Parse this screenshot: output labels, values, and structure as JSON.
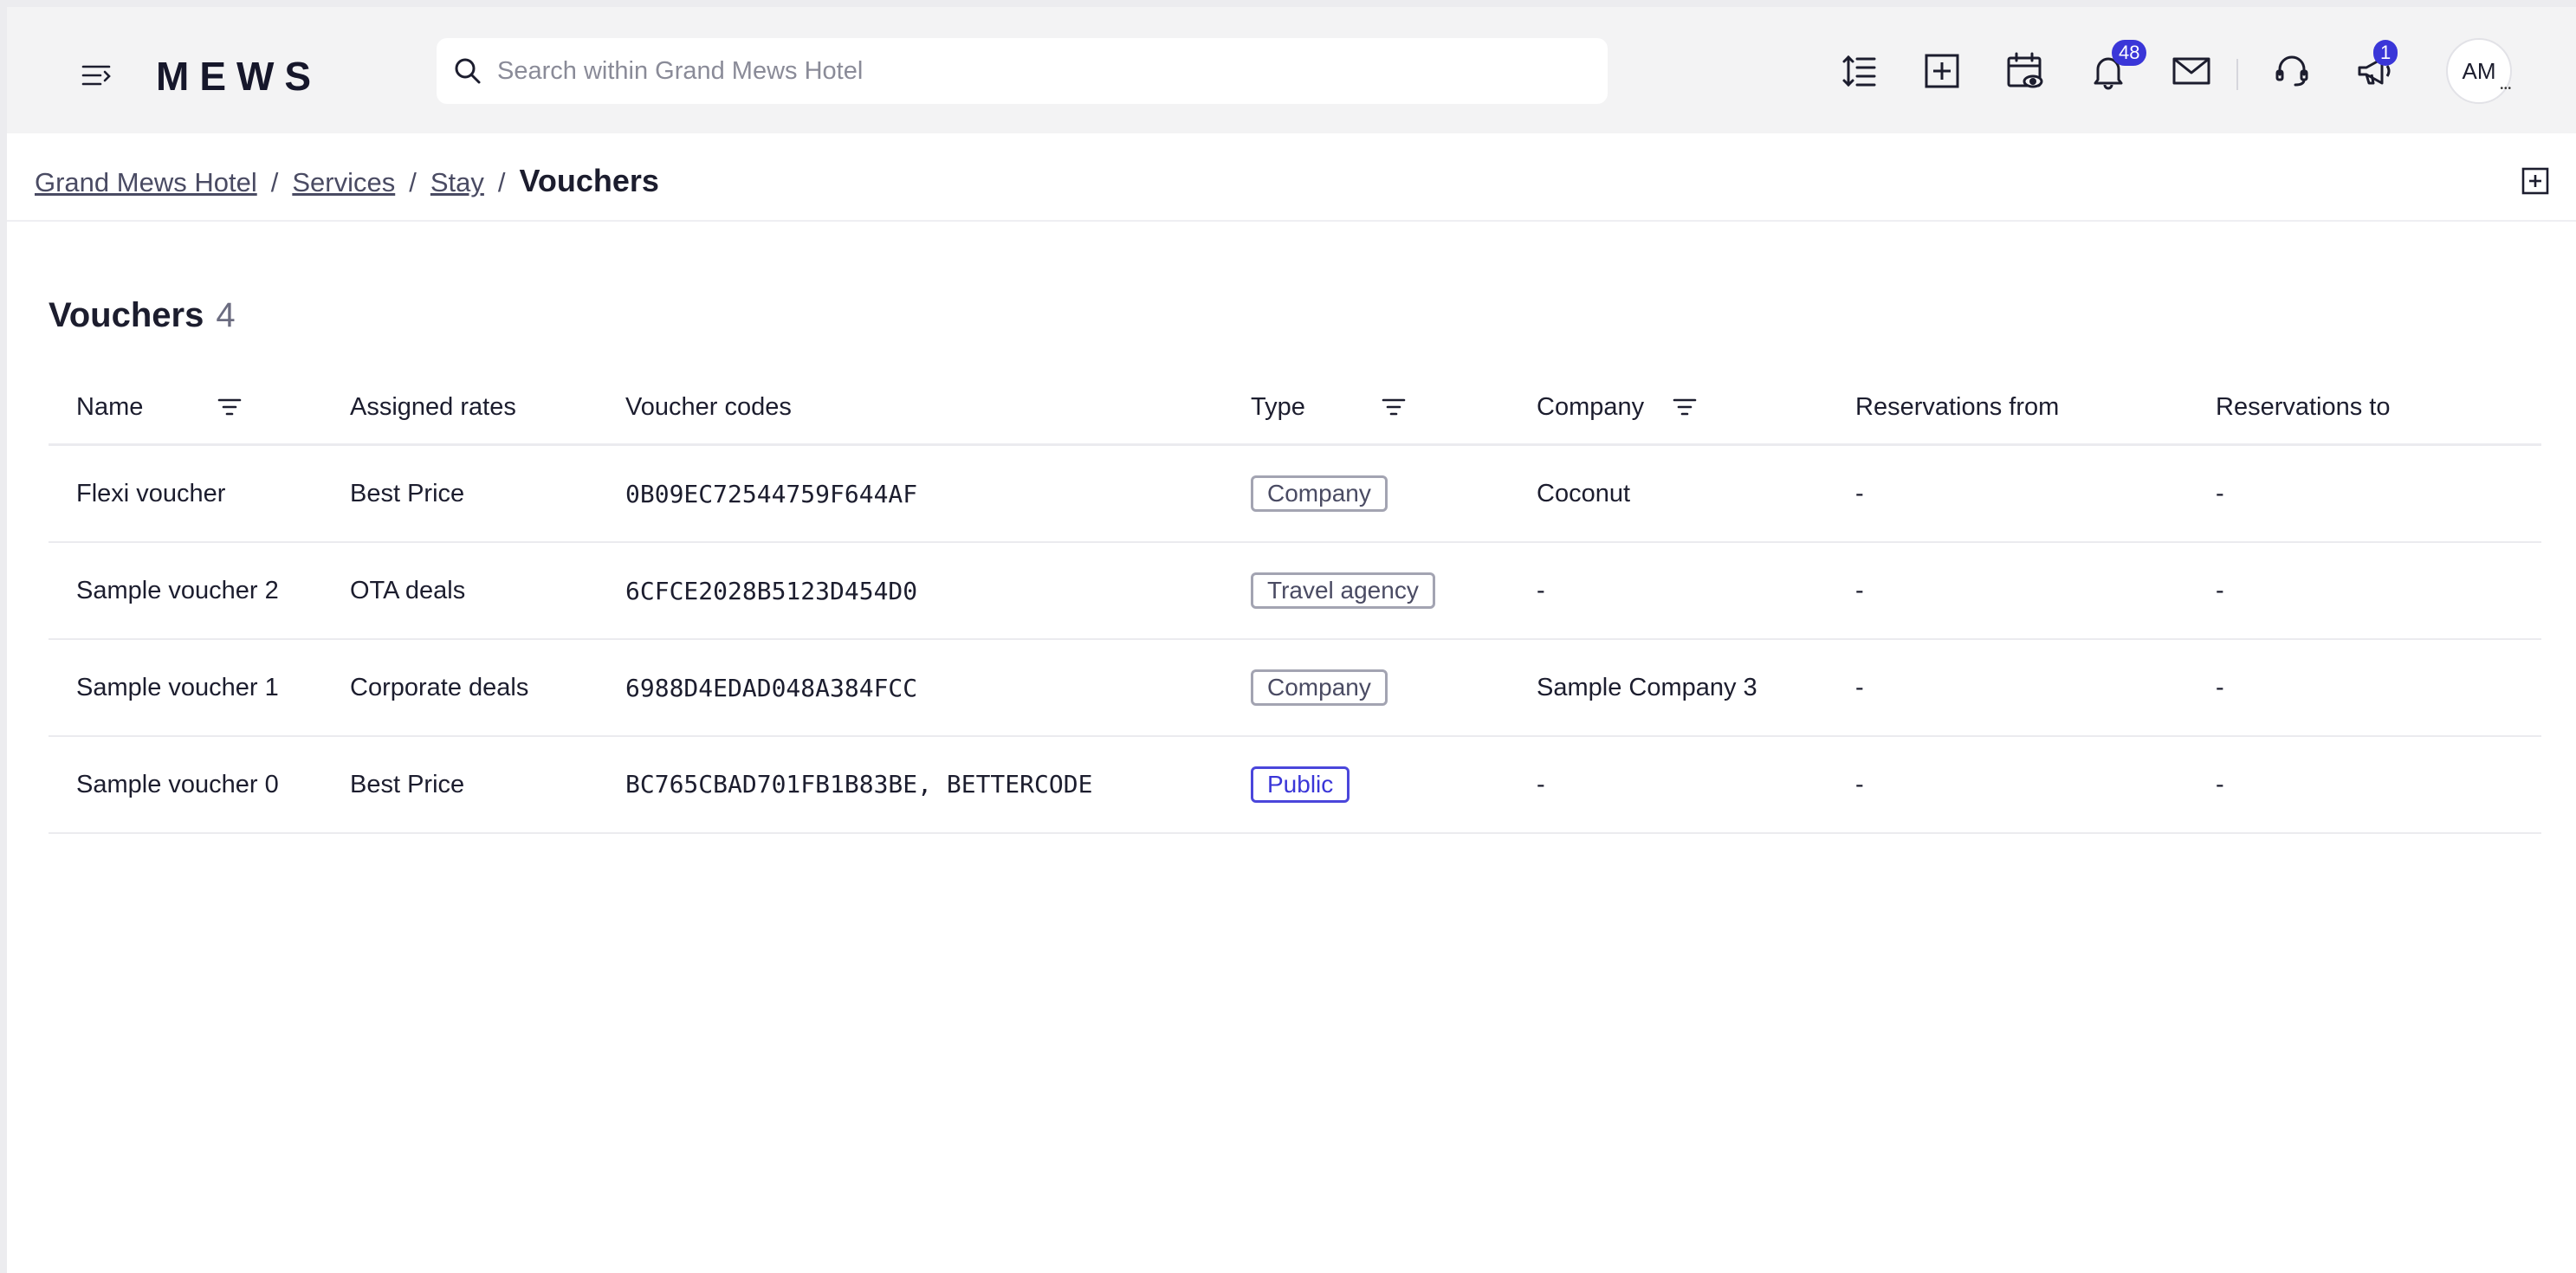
{
  "app": {
    "logo": "MEWS"
  },
  "search": {
    "placeholder": "Search within Grand Mews Hotel"
  },
  "toolbar": {
    "notifications_count": "48",
    "announcements_count": "1",
    "avatar_initials": "AM"
  },
  "breadcrumb": {
    "items": [
      "Grand Mews Hotel",
      "Services",
      "Stay"
    ],
    "separator": "/",
    "current": "Vouchers"
  },
  "page": {
    "title": "Vouchers",
    "count": "4"
  },
  "table": {
    "columns": [
      "Name",
      "Assigned rates",
      "Voucher codes",
      "Type",
      "Company",
      "Reservations from",
      "Reservations to"
    ],
    "rows": [
      {
        "name": "Flexi voucher",
        "rates": "Best Price",
        "codes": "0B09EC72544759F644AF",
        "type": "Company",
        "company": "Coconut",
        "from": "-",
        "to": "-"
      },
      {
        "name": "Sample voucher 2",
        "rates": "OTA deals",
        "codes": "6CFCE2028B5123D454D0",
        "type": "Travel agency",
        "company": "-",
        "from": "-",
        "to": "-"
      },
      {
        "name": "Sample voucher 1",
        "rates": "Corporate deals",
        "codes": "6988D4EDAD048A384FCC",
        "type": "Company",
        "company": "Sample Company 3",
        "from": "-",
        "to": "-"
      },
      {
        "name": "Sample voucher 0",
        "rates": "Best Price",
        "codes": "BC765CBAD701FB1B83BE, BETTERCODE",
        "type": "Public",
        "company": "-",
        "from": "-",
        "to": "-"
      }
    ]
  },
  "colors": {
    "accent": "#3a36d8",
    "topbar_bg": "#f3f3f4",
    "text": "#1c1d2e"
  }
}
